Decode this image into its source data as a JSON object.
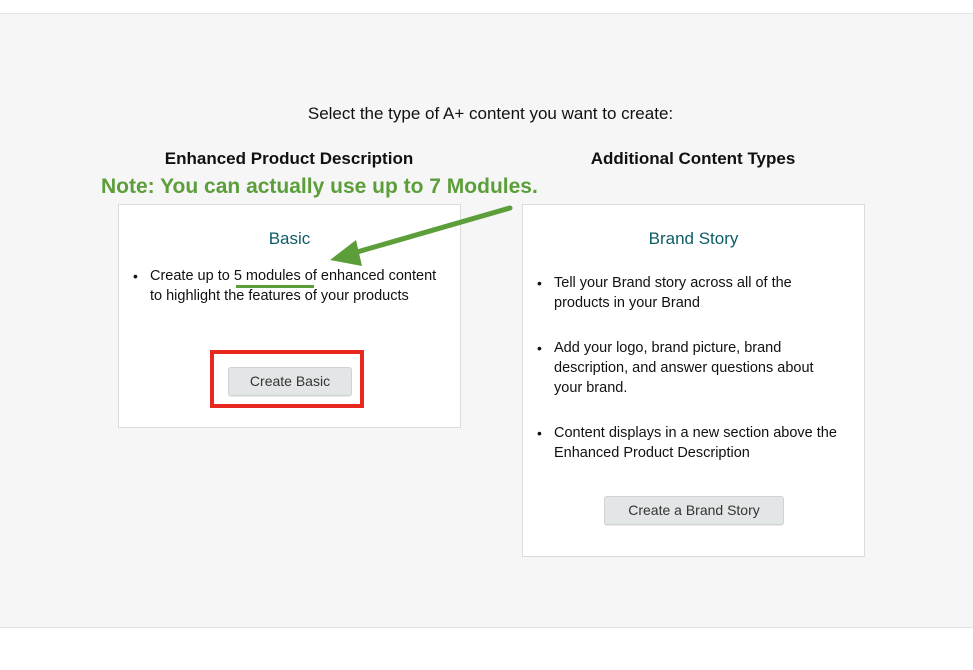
{
  "page": {
    "prompt": "Select the type of A+ content you want to create:"
  },
  "columns": {
    "left_heading": "Enhanced Product Description",
    "right_heading": "Additional Content Types"
  },
  "annotation": {
    "note": "Note: You can actually use up to 7 Modules.",
    "color": "#5b9e3a",
    "highlight_color": "#e8281e"
  },
  "basic_card": {
    "title": "Basic",
    "bullet_prefix": "Create up to ",
    "bullet_highlight": "5 modules",
    "bullet_suffix": " of enhanced content to highlight the features of your products",
    "button_label": "Create Basic"
  },
  "brand_card": {
    "title": "Brand Story",
    "bullets": [
      "Tell your Brand story across all of the products in your Brand",
      "Add your logo, brand picture, brand description, and answer questions about your brand.",
      "Content displays in a new section above the Enhanced Product Description"
    ],
    "button_label": "Create a Brand Story"
  }
}
